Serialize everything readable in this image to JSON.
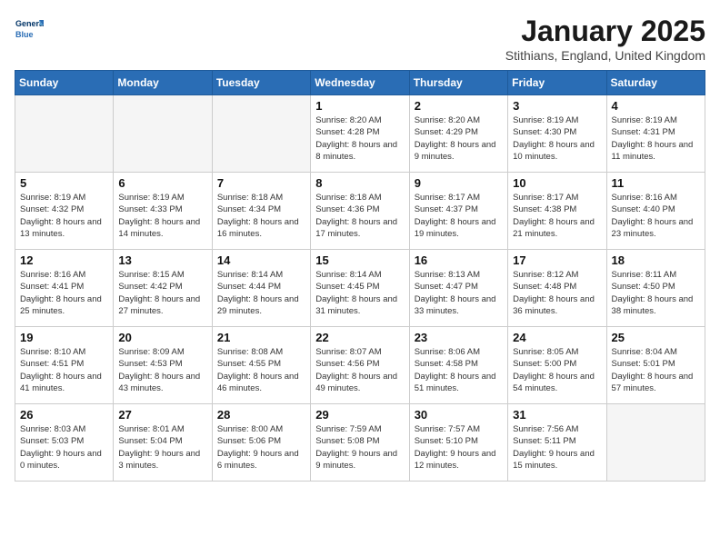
{
  "header": {
    "logo_line1": "General",
    "logo_line2": "Blue",
    "month_year": "January 2025",
    "location": "Stithians, England, United Kingdom"
  },
  "weekdays": [
    "Sunday",
    "Monday",
    "Tuesday",
    "Wednesday",
    "Thursday",
    "Friday",
    "Saturday"
  ],
  "weeks": [
    [
      {
        "day": "",
        "empty": true
      },
      {
        "day": "",
        "empty": true
      },
      {
        "day": "",
        "empty": true
      },
      {
        "day": "1",
        "sunrise": "Sunrise: 8:20 AM",
        "sunset": "Sunset: 4:28 PM",
        "daylight": "Daylight: 8 hours and 8 minutes."
      },
      {
        "day": "2",
        "sunrise": "Sunrise: 8:20 AM",
        "sunset": "Sunset: 4:29 PM",
        "daylight": "Daylight: 8 hours and 9 minutes."
      },
      {
        "day": "3",
        "sunrise": "Sunrise: 8:19 AM",
        "sunset": "Sunset: 4:30 PM",
        "daylight": "Daylight: 8 hours and 10 minutes."
      },
      {
        "day": "4",
        "sunrise": "Sunrise: 8:19 AM",
        "sunset": "Sunset: 4:31 PM",
        "daylight": "Daylight: 8 hours and 11 minutes."
      }
    ],
    [
      {
        "day": "5",
        "sunrise": "Sunrise: 8:19 AM",
        "sunset": "Sunset: 4:32 PM",
        "daylight": "Daylight: 8 hours and 13 minutes."
      },
      {
        "day": "6",
        "sunrise": "Sunrise: 8:19 AM",
        "sunset": "Sunset: 4:33 PM",
        "daylight": "Daylight: 8 hours and 14 minutes."
      },
      {
        "day": "7",
        "sunrise": "Sunrise: 8:18 AM",
        "sunset": "Sunset: 4:34 PM",
        "daylight": "Daylight: 8 hours and 16 minutes."
      },
      {
        "day": "8",
        "sunrise": "Sunrise: 8:18 AM",
        "sunset": "Sunset: 4:36 PM",
        "daylight": "Daylight: 8 hours and 17 minutes."
      },
      {
        "day": "9",
        "sunrise": "Sunrise: 8:17 AM",
        "sunset": "Sunset: 4:37 PM",
        "daylight": "Daylight: 8 hours and 19 minutes."
      },
      {
        "day": "10",
        "sunrise": "Sunrise: 8:17 AM",
        "sunset": "Sunset: 4:38 PM",
        "daylight": "Daylight: 8 hours and 21 minutes."
      },
      {
        "day": "11",
        "sunrise": "Sunrise: 8:16 AM",
        "sunset": "Sunset: 4:40 PM",
        "daylight": "Daylight: 8 hours and 23 minutes."
      }
    ],
    [
      {
        "day": "12",
        "sunrise": "Sunrise: 8:16 AM",
        "sunset": "Sunset: 4:41 PM",
        "daylight": "Daylight: 8 hours and 25 minutes."
      },
      {
        "day": "13",
        "sunrise": "Sunrise: 8:15 AM",
        "sunset": "Sunset: 4:42 PM",
        "daylight": "Daylight: 8 hours and 27 minutes."
      },
      {
        "day": "14",
        "sunrise": "Sunrise: 8:14 AM",
        "sunset": "Sunset: 4:44 PM",
        "daylight": "Daylight: 8 hours and 29 minutes."
      },
      {
        "day": "15",
        "sunrise": "Sunrise: 8:14 AM",
        "sunset": "Sunset: 4:45 PM",
        "daylight": "Daylight: 8 hours and 31 minutes."
      },
      {
        "day": "16",
        "sunrise": "Sunrise: 8:13 AM",
        "sunset": "Sunset: 4:47 PM",
        "daylight": "Daylight: 8 hours and 33 minutes."
      },
      {
        "day": "17",
        "sunrise": "Sunrise: 8:12 AM",
        "sunset": "Sunset: 4:48 PM",
        "daylight": "Daylight: 8 hours and 36 minutes."
      },
      {
        "day": "18",
        "sunrise": "Sunrise: 8:11 AM",
        "sunset": "Sunset: 4:50 PM",
        "daylight": "Daylight: 8 hours and 38 minutes."
      }
    ],
    [
      {
        "day": "19",
        "sunrise": "Sunrise: 8:10 AM",
        "sunset": "Sunset: 4:51 PM",
        "daylight": "Daylight: 8 hours and 41 minutes."
      },
      {
        "day": "20",
        "sunrise": "Sunrise: 8:09 AM",
        "sunset": "Sunset: 4:53 PM",
        "daylight": "Daylight: 8 hours and 43 minutes."
      },
      {
        "day": "21",
        "sunrise": "Sunrise: 8:08 AM",
        "sunset": "Sunset: 4:55 PM",
        "daylight": "Daylight: 8 hours and 46 minutes."
      },
      {
        "day": "22",
        "sunrise": "Sunrise: 8:07 AM",
        "sunset": "Sunset: 4:56 PM",
        "daylight": "Daylight: 8 hours and 49 minutes."
      },
      {
        "day": "23",
        "sunrise": "Sunrise: 8:06 AM",
        "sunset": "Sunset: 4:58 PM",
        "daylight": "Daylight: 8 hours and 51 minutes."
      },
      {
        "day": "24",
        "sunrise": "Sunrise: 8:05 AM",
        "sunset": "Sunset: 5:00 PM",
        "daylight": "Daylight: 8 hours and 54 minutes."
      },
      {
        "day": "25",
        "sunrise": "Sunrise: 8:04 AM",
        "sunset": "Sunset: 5:01 PM",
        "daylight": "Daylight: 8 hours and 57 minutes."
      }
    ],
    [
      {
        "day": "26",
        "sunrise": "Sunrise: 8:03 AM",
        "sunset": "Sunset: 5:03 PM",
        "daylight": "Daylight: 9 hours and 0 minutes."
      },
      {
        "day": "27",
        "sunrise": "Sunrise: 8:01 AM",
        "sunset": "Sunset: 5:04 PM",
        "daylight": "Daylight: 9 hours and 3 minutes."
      },
      {
        "day": "28",
        "sunrise": "Sunrise: 8:00 AM",
        "sunset": "Sunset: 5:06 PM",
        "daylight": "Daylight: 9 hours and 6 minutes."
      },
      {
        "day": "29",
        "sunrise": "Sunrise: 7:59 AM",
        "sunset": "Sunset: 5:08 PM",
        "daylight": "Daylight: 9 hours and 9 minutes."
      },
      {
        "day": "30",
        "sunrise": "Sunrise: 7:57 AM",
        "sunset": "Sunset: 5:10 PM",
        "daylight": "Daylight: 9 hours and 12 minutes."
      },
      {
        "day": "31",
        "sunrise": "Sunrise: 7:56 AM",
        "sunset": "Sunset: 5:11 PM",
        "daylight": "Daylight: 9 hours and 15 minutes."
      },
      {
        "day": "",
        "empty": true
      }
    ]
  ]
}
